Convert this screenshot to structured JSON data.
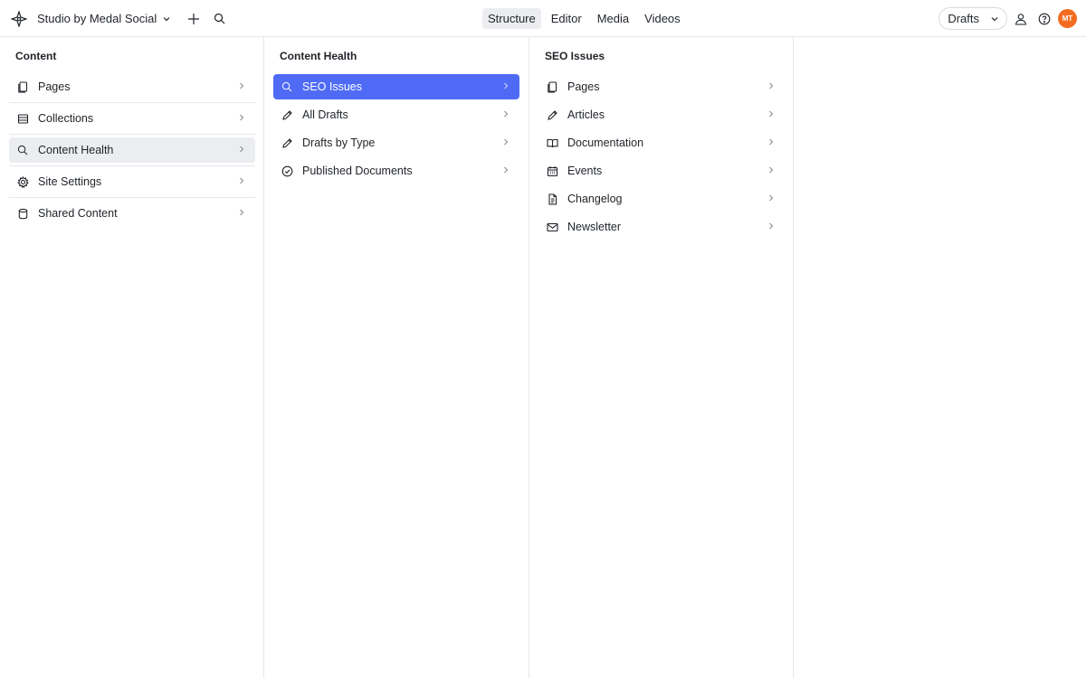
{
  "topbar": {
    "workspace_name": "Studio by Medal Social",
    "nav_tabs": [
      "Structure",
      "Editor",
      "Media",
      "Videos"
    ],
    "perspective": "Drafts",
    "avatar_initials": "MT"
  },
  "panes": [
    {
      "title": "Content",
      "items": [
        {
          "label": "Pages",
          "icon": "document-icon"
        },
        {
          "label": "Collections",
          "icon": "list-icon"
        },
        {
          "label": "Content Health",
          "icon": "search-icon"
        },
        {
          "label": "Site Settings",
          "icon": "gear-icon"
        },
        {
          "label": "Shared Content",
          "icon": "database-icon"
        }
      ]
    },
    {
      "title": "Content Health",
      "items": [
        {
          "label": "SEO Issues",
          "icon": "search-icon"
        },
        {
          "label": "All Drafts",
          "icon": "pencil-icon"
        },
        {
          "label": "Drafts by Type",
          "icon": "pencil-icon"
        },
        {
          "label": "Published Documents",
          "icon": "check-circle-icon"
        }
      ]
    },
    {
      "title": "SEO Issues",
      "items": [
        {
          "label": "Pages",
          "icon": "document-icon"
        },
        {
          "label": "Articles",
          "icon": "pencil-icon"
        },
        {
          "label": "Documentation",
          "icon": "book-icon"
        },
        {
          "label": "Events",
          "icon": "calendar-icon"
        },
        {
          "label": "Changelog",
          "icon": "file-text-icon"
        },
        {
          "label": "Newsletter",
          "icon": "envelope-icon"
        }
      ]
    }
  ],
  "colors": {
    "selected_item_bg": "#4f6bf5",
    "highlighted_item_bg": "#ebedf0",
    "avatar_bg": "#f36c21"
  }
}
